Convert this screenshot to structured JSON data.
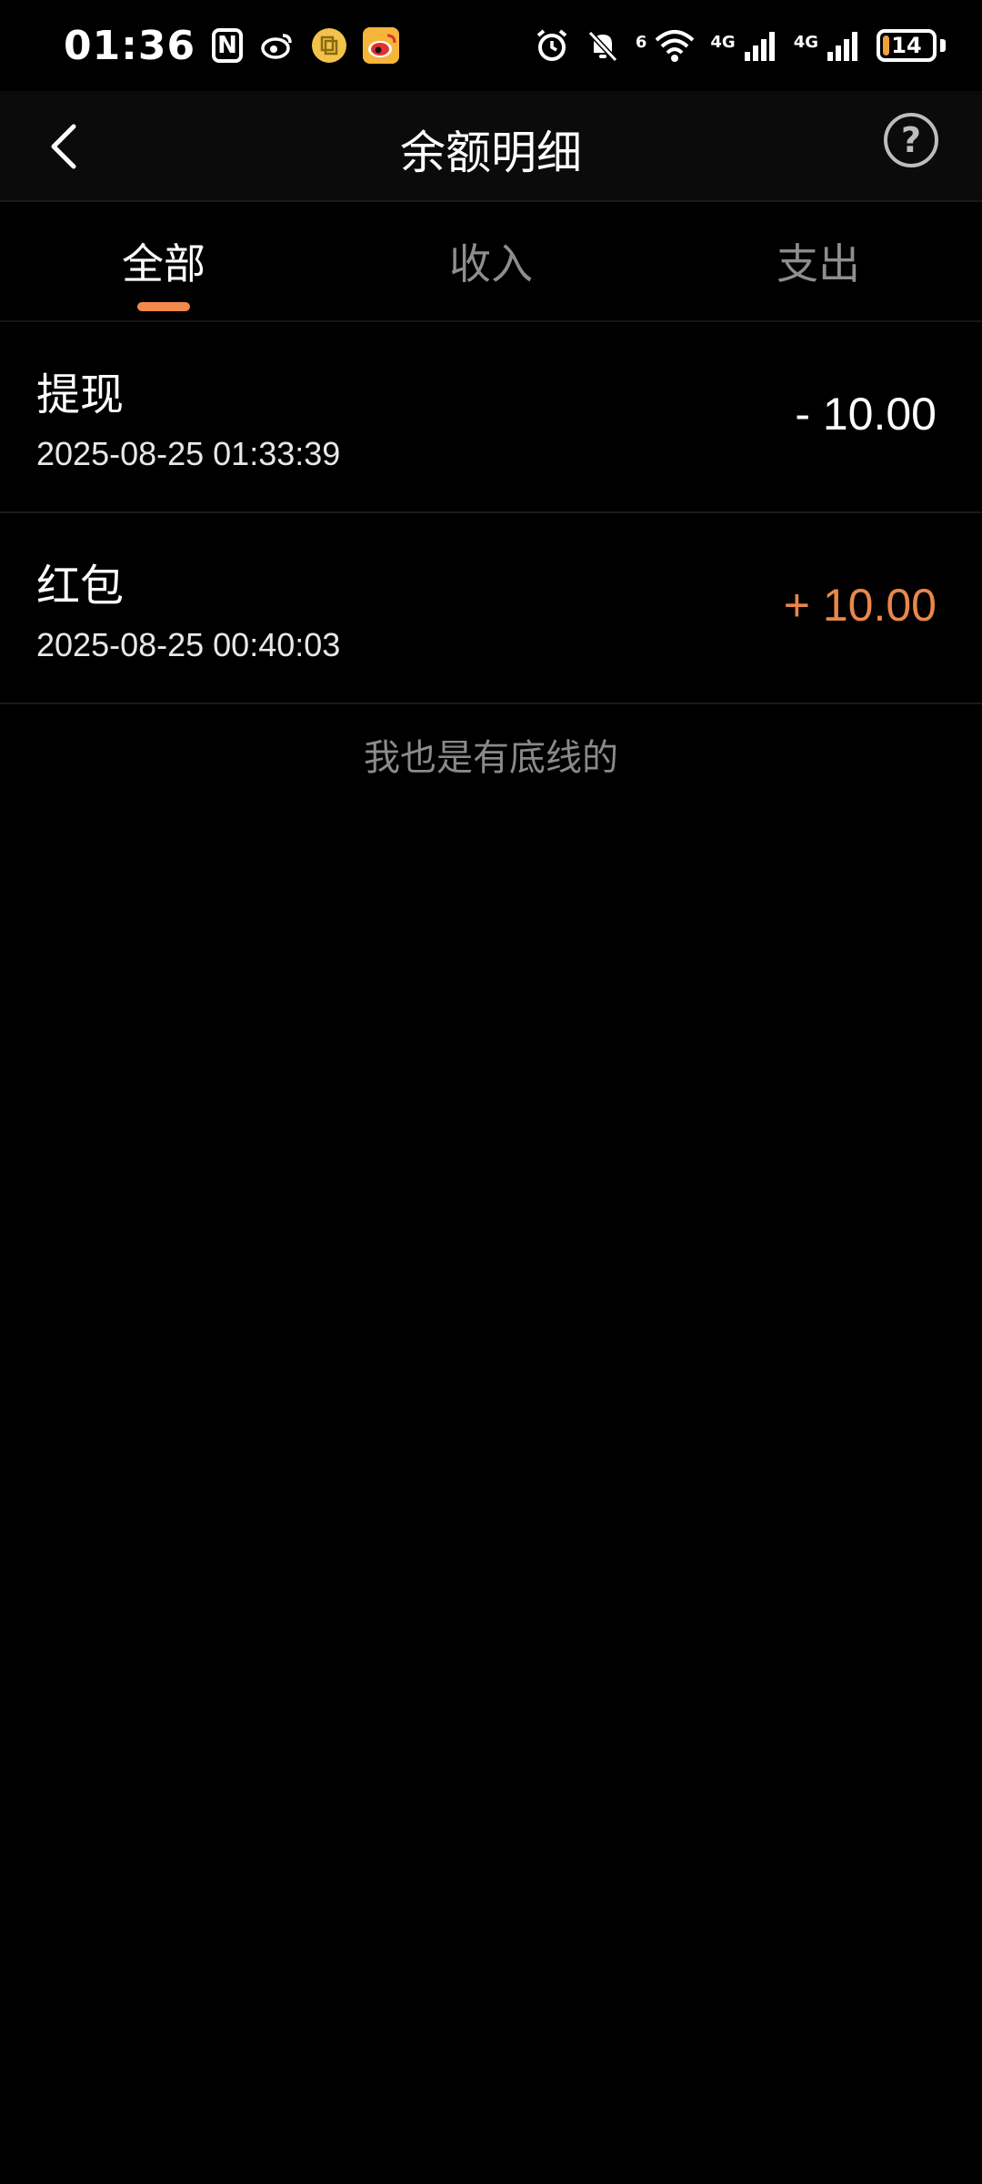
{
  "status_bar": {
    "time": "01:36",
    "nfc_label": "N",
    "signal_label_1": "6",
    "signal_label_2": "4G",
    "signal_label_3": "4G",
    "battery_level": "14",
    "battery_fraction": 0.14,
    "icons": [
      "nfc-icon",
      "weibo-small-icon",
      "coin-icon",
      "weibo-app-icon",
      "alarm-icon",
      "bell-off-icon",
      "wifi-icon",
      "signal-icon",
      "signal-icon",
      "battery-icon"
    ]
  },
  "header": {
    "title": "余额明细",
    "back_icon": "chevron-left-icon",
    "help_label": "?"
  },
  "tabs": [
    {
      "label": "全部",
      "active": true
    },
    {
      "label": "收入",
      "active": false
    },
    {
      "label": "支出",
      "active": false
    }
  ],
  "records": [
    {
      "title": "提现",
      "time": "2025-08-25 01:33:39",
      "amount": "- 10.00",
      "type": "out"
    },
    {
      "title": "红包",
      "time": "2025-08-25 00:40:03",
      "amount": "+ 10.00",
      "type": "in"
    }
  ],
  "footer_note": "我也是有底线的",
  "colors": {
    "accent": "#f2894a",
    "income": "#e9874a",
    "background": "#000000"
  }
}
